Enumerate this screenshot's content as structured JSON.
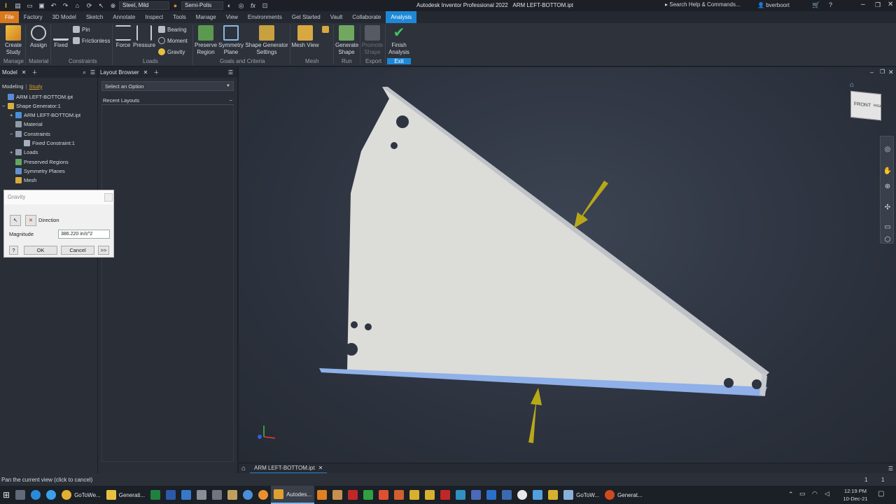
{
  "qat": {
    "material": "Steel, Mild",
    "appearance": "Semi-Polis",
    "fx": "fx"
  },
  "title": {
    "app": "Autodesk Inventor Professional 2022",
    "doc": "ARM LEFT-BOTTOM.ipt"
  },
  "search": {
    "placeholder": "Search Help & Commands..."
  },
  "user": {
    "name": "bverboort"
  },
  "tabs": [
    "File",
    "Factory",
    "3D Model",
    "Sketch",
    "Annotate",
    "Inspect",
    "Tools",
    "Manage",
    "View",
    "Environments",
    "Get Started",
    "Vault",
    "Collaborate",
    "Analysis"
  ],
  "ribbon": {
    "create_study": "Create\nStudy",
    "assign": "Assign",
    "fixed": "Fixed",
    "pin": "Pin",
    "frictionless": "Frictionless",
    "force": "Force",
    "pressure": "Pressure",
    "bearing": "Bearing",
    "moment": "Moment",
    "gravity": "Gravity",
    "preserve_region": "Preserve\nRegion",
    "symmetry_plane": "Symmetry\nPlane",
    "shape_generator_settings": "Shape Generator\nSettings",
    "mesh_view": "Mesh View",
    "generate_shape": "Generate\nShape",
    "promote_shape": "Promote\nShape",
    "finish_analysis": "Finish\nAnalysis",
    "groups": {
      "manage": "Manage",
      "material": "Material",
      "constraints": "Constraints",
      "loads": "Loads",
      "goals": "Goals and Criteria",
      "mesh": "Mesh",
      "run": "Run",
      "export": "Export",
      "exit": "Exit"
    }
  },
  "model_panel": {
    "tab": "Model",
    "modeling": "Modeling",
    "study": "Study",
    "tree": [
      "ARM LEFT-BOTTOM.ipt",
      "Shape Generator:1",
      "ARM LEFT-BOTTOM.ipt",
      "Material",
      "Constraints",
      "Fixed Constraint:1",
      "Loads",
      "Preserved Regions",
      "Symmetry Planes",
      "Mesh"
    ]
  },
  "layout_panel": {
    "tab": "Layout Browser",
    "select": "Select an Option",
    "recent": "Recent Layouts"
  },
  "gravity_dialog": {
    "title": "Gravity",
    "direction": "Direction",
    "magnitude_label": "Magnitude",
    "magnitude": "386.220 in/s^2",
    "ok": "OK",
    "cancel": "Cancel",
    "more": ">>"
  },
  "viewcube": {
    "front": "FRONT",
    "right": "RIGHT"
  },
  "doc_tab": "ARM LEFT-BOTTOM.ipt",
  "status": {
    "text": "Pan the current view (click to cancel)",
    "n1": "1",
    "n2": "1"
  },
  "taskbar": {
    "items": [
      "GoToWe...",
      "Generati...",
      "Autodes...",
      "GoToW...",
      "Generat..."
    ],
    "time": "12:19 PM",
    "date": "10-Dec-21"
  },
  "colors": {
    "accent": "#1e88d8",
    "file_tab": "#d9791e",
    "arrow": "#b8a818",
    "part": "#dcdcd8"
  }
}
